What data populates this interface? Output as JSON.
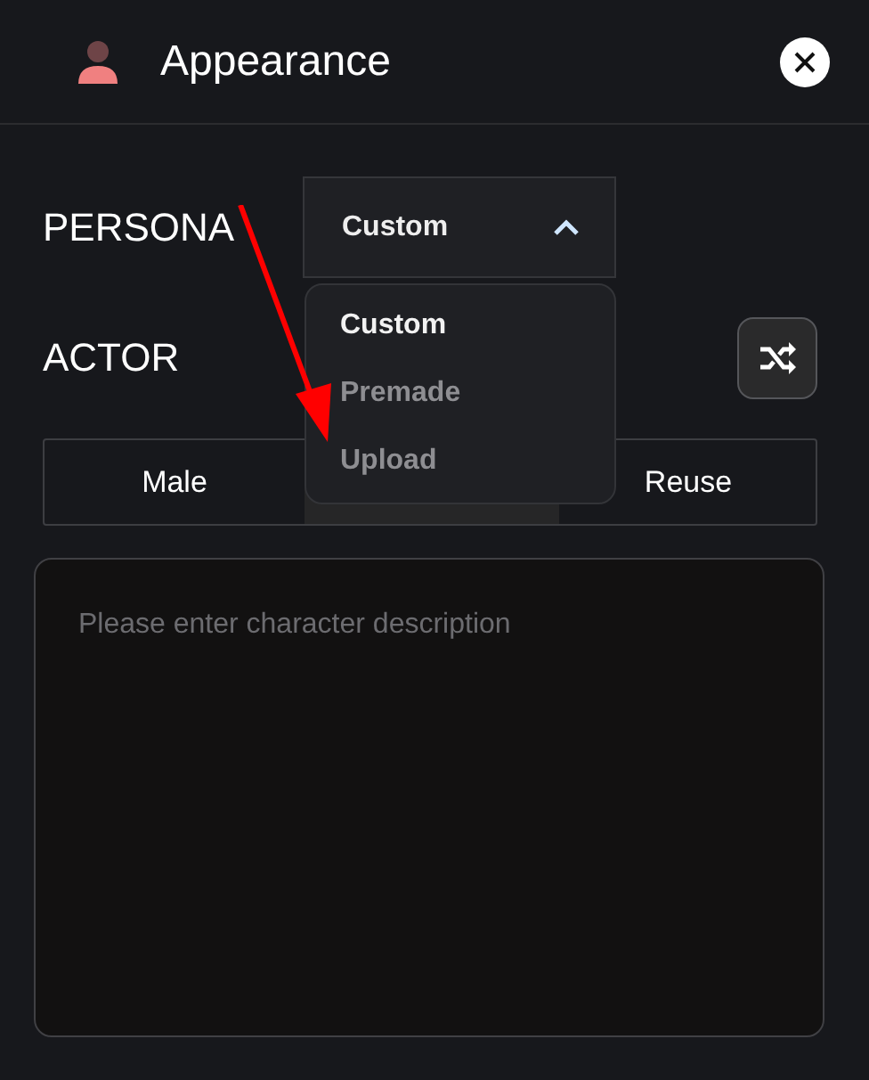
{
  "header": {
    "title": "Appearance"
  },
  "persona": {
    "label": "PERSONA",
    "value": "Custom",
    "expanded": true,
    "options": [
      {
        "label": "Custom",
        "selected": true
      },
      {
        "label": "Premade",
        "selected": false
      },
      {
        "label": "Upload",
        "selected": false
      }
    ]
  },
  "actor": {
    "label": "ACTOR",
    "segments": [
      {
        "label": "Male",
        "selected": false
      },
      {
        "selected": true
      },
      {
        "label": "Reuse",
        "selected": false
      }
    ]
  },
  "description": {
    "placeholder": "Please enter character description"
  }
}
